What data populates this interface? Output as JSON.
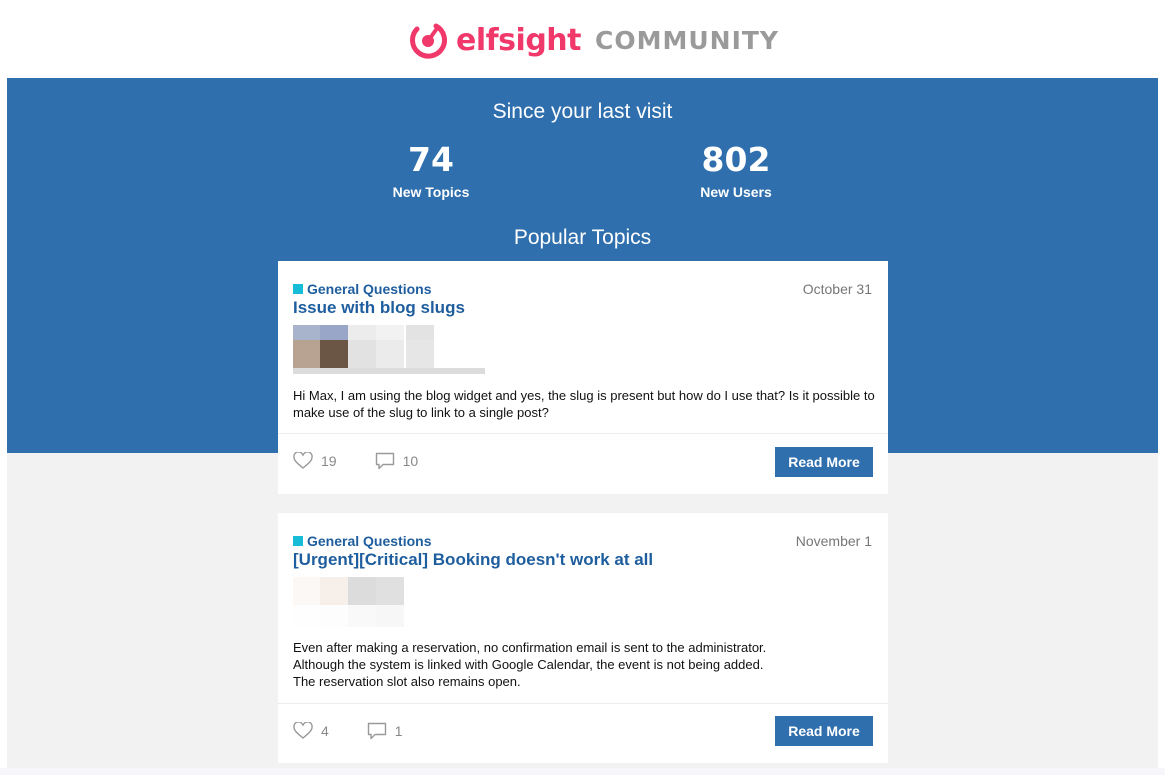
{
  "brand": {
    "name": "elfsight",
    "section": "COMMUNITY"
  },
  "hero": {
    "since_title": "Since your last visit",
    "stats": [
      {
        "value": "74",
        "label": "New Topics"
      },
      {
        "value": "802",
        "label": "New Users"
      }
    ],
    "popular_title": "Popular Topics"
  },
  "topics": [
    {
      "category": "General Questions",
      "date": "October 31",
      "title": "Issue with blog slugs",
      "excerpt": "Hi Max, I am using the blog widget and yes, the slug is present but how do I use that? Is it possible to make use of the slug to link to a single post?",
      "likes": "19",
      "comments": "10",
      "button": "Read More"
    },
    {
      "category": "General Questions",
      "date": "November 1",
      "title": "[Urgent][Critical] Booking doesn't work at all",
      "excerpt_lines": [
        "Even after making a reservation, no confirmation email is sent to the administrator.",
        "Although the system is linked with Google Calendar, the event is not being added.",
        "The reservation slot also remains open."
      ],
      "likes": "4",
      "comments": "1",
      "button": "Read More"
    }
  ],
  "colors": {
    "brand": "#f0386b",
    "hero": "#2f6fad",
    "category": "#17bcd6",
    "link": "#1f5e9e"
  }
}
